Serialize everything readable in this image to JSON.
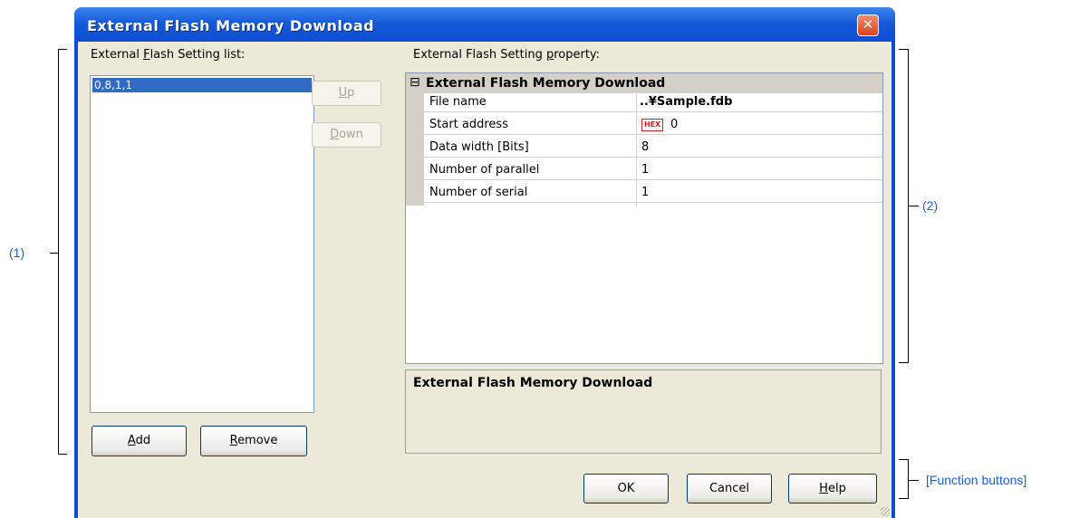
{
  "dialog": {
    "title": "External Flash Memory Download",
    "close_glyph": "✕"
  },
  "left": {
    "list_label_pre": "External ",
    "list_label_u": "F",
    "list_label_post": "lash Setting list:",
    "items": [
      "0,8,1,1"
    ],
    "up_pre": "",
    "up_u": "U",
    "up_post": "p",
    "down_pre": "",
    "down_u": "D",
    "down_post": "own",
    "add_u": "A",
    "add_post": "dd",
    "remove_u": "R",
    "remove_post": "emove"
  },
  "right": {
    "prop_label_pre": "External Flash Setting ",
    "prop_label_u": "p",
    "prop_label_post": "roperty:",
    "category": "External Flash Memory Download",
    "collapse_glyph": "⊟",
    "rows": [
      {
        "name": "File name",
        "value": "..¥Sample.fdb"
      },
      {
        "name": "Start address",
        "value": "0",
        "badge": "HEX"
      },
      {
        "name": "Data width [Bits]",
        "value": "8"
      },
      {
        "name": "Number of parallel",
        "value": "1"
      },
      {
        "name": "Number of serial",
        "value": "1"
      }
    ],
    "description": "External Flash Memory Download"
  },
  "buttons": {
    "ok": "OK",
    "cancel": "Cancel",
    "help_u": "H",
    "help_post": "elp"
  },
  "callouts": {
    "one": "(1)",
    "two": "(2)",
    "function_buttons": "[Function buttons]"
  },
  "colors": {
    "title_bar": "#1659d8",
    "selection": "#316ac5",
    "callout": "#1a5fd0",
    "dialog_bg": "#ece9d8"
  }
}
